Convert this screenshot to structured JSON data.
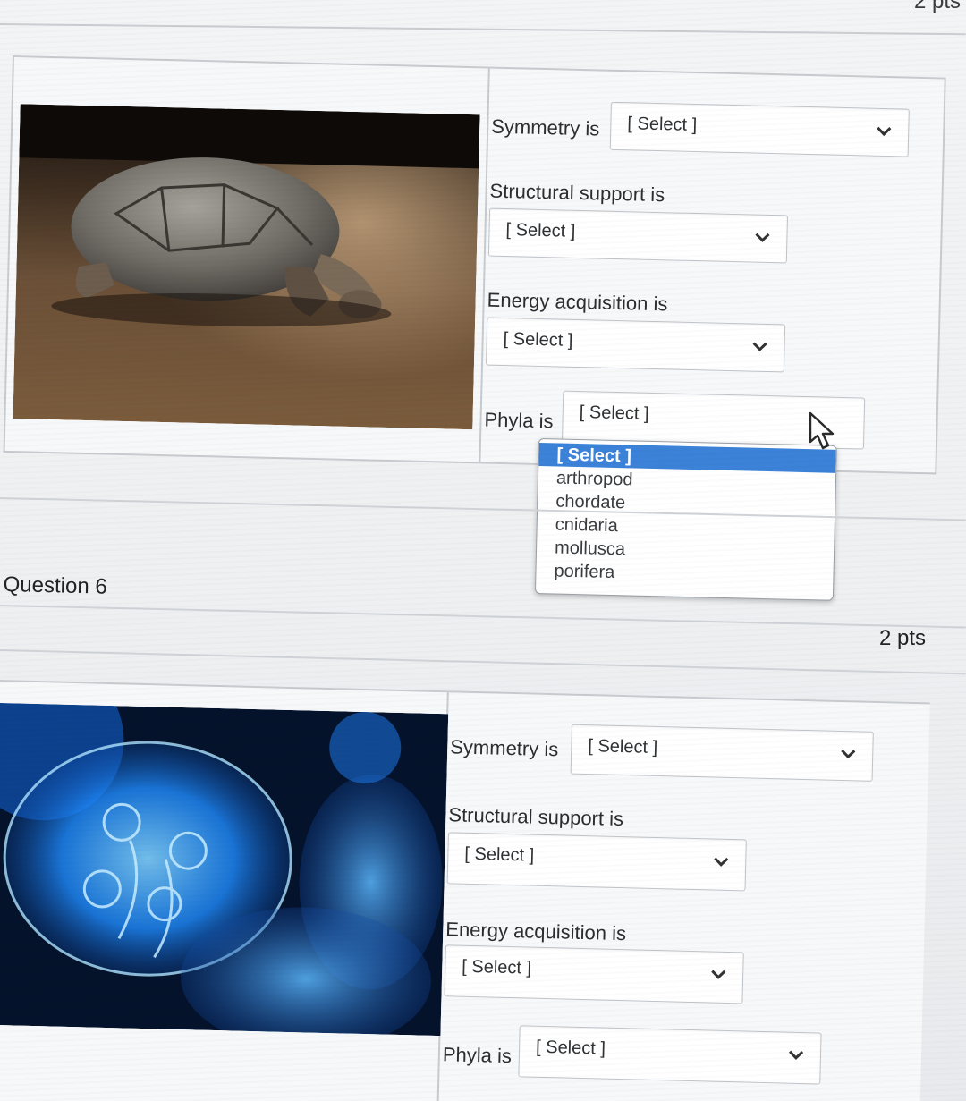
{
  "header": {
    "points": "2 pts"
  },
  "question5": {
    "image_label": "tortoise-image",
    "fields": [
      {
        "label": "Symmetry is",
        "value": "[ Select ]"
      },
      {
        "label": "Structural support is",
        "value": "[ Select ]"
      },
      {
        "label": "Energy acquisition is",
        "value": "[ Select ]"
      },
      {
        "label": "Phyla is",
        "value": "[ Select ]"
      }
    ],
    "phyla_dropdown": {
      "options": [
        "[ Select ]",
        "arthropod",
        "chordate",
        "cnidaria",
        "mollusca",
        "porifera"
      ],
      "highlighted": "[ Select ]"
    }
  },
  "question6": {
    "title": "Question 6",
    "points": "2 pts",
    "fields": [
      {
        "label": "Symmetry is",
        "value": "[ Select ]"
      },
      {
        "label": "Structural support is",
        "value": "[ Select ]"
      },
      {
        "label": "Energy acquisition is",
        "value": "[ Select ]"
      },
      {
        "label": "Phyla is",
        "value": "[ Select ]"
      }
    ]
  },
  "colors": {
    "highlight": "#3b82d8",
    "border": "#c7cbcf",
    "jelly": "#1f8cff"
  },
  "icons": {
    "select_chevron": "chevron-down-icon",
    "mouse": "cursor-arrow-icon"
  }
}
